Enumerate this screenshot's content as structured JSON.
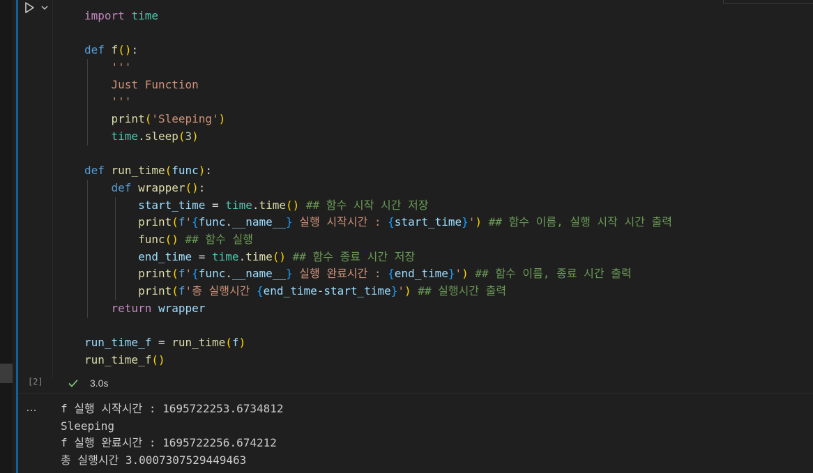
{
  "cell": {
    "execution_count": "[2]",
    "status_time": "3.0s",
    "more_label": "…",
    "icons": {
      "run": "play-icon",
      "run_menu": "chevron-down-icon",
      "status": "check-icon"
    }
  },
  "code": [
    [
      [
        "kw2",
        "import"
      ],
      [
        "op",
        " "
      ],
      [
        "mod",
        "time"
      ]
    ],
    [],
    [
      [
        "kw",
        "def"
      ],
      [
        "op",
        " "
      ],
      [
        "fn",
        "f"
      ],
      [
        "br1",
        "()"
      ],
      [
        "op",
        ":"
      ]
    ],
    [
      [
        "op",
        "    "
      ],
      [
        "str",
        "'''"
      ]
    ],
    [
      [
        "op",
        "    "
      ],
      [
        "str",
        "Just Function"
      ]
    ],
    [
      [
        "op",
        "    "
      ],
      [
        "str",
        "'''"
      ]
    ],
    [
      [
        "op",
        "    "
      ],
      [
        "fn",
        "print"
      ],
      [
        "br1",
        "("
      ],
      [
        "str",
        "'Sleeping'"
      ],
      [
        "br1",
        ")"
      ]
    ],
    [
      [
        "op",
        "    "
      ],
      [
        "mod",
        "time"
      ],
      [
        "op",
        "."
      ],
      [
        "fn",
        "sleep"
      ],
      [
        "br1",
        "("
      ],
      [
        "num",
        "3"
      ],
      [
        "br1",
        ")"
      ]
    ],
    [],
    [
      [
        "kw",
        "def"
      ],
      [
        "op",
        " "
      ],
      [
        "fn",
        "run_time"
      ],
      [
        "br1",
        "("
      ],
      [
        "var",
        "func"
      ],
      [
        "br1",
        ")"
      ],
      [
        "op",
        ":"
      ]
    ],
    [
      [
        "op",
        "    "
      ],
      [
        "kw",
        "def"
      ],
      [
        "op",
        " "
      ],
      [
        "fn",
        "wrapper"
      ],
      [
        "br1",
        "()"
      ],
      [
        "op",
        ":"
      ]
    ],
    [
      [
        "op",
        "        "
      ],
      [
        "var",
        "start_time"
      ],
      [
        "op",
        " = "
      ],
      [
        "mod",
        "time"
      ],
      [
        "op",
        "."
      ],
      [
        "fn",
        "time"
      ],
      [
        "br1",
        "()"
      ],
      [
        "op",
        " "
      ],
      [
        "cmt",
        "## 함수 시작 시간 저장"
      ]
    ],
    [
      [
        "op",
        "        "
      ],
      [
        "fn",
        "print"
      ],
      [
        "br1",
        "("
      ],
      [
        "kw",
        "f"
      ],
      [
        "str",
        "'"
      ],
      [
        "br3",
        "{"
      ],
      [
        "var",
        "func"
      ],
      [
        "op",
        "."
      ],
      [
        "var",
        "__name__"
      ],
      [
        "br3",
        "}"
      ],
      [
        "str",
        " 실행 시작시간 : "
      ],
      [
        "br3",
        "{"
      ],
      [
        "var",
        "start_time"
      ],
      [
        "br3",
        "}"
      ],
      [
        "str",
        "'"
      ],
      [
        "br1",
        ")"
      ],
      [
        "op",
        " "
      ],
      [
        "cmt",
        "## 함수 이름, 실행 시작 시간 출력"
      ]
    ],
    [
      [
        "op",
        "        "
      ],
      [
        "fn",
        "func"
      ],
      [
        "br1",
        "()"
      ],
      [
        "op",
        " "
      ],
      [
        "cmt",
        "## 함수 실행"
      ]
    ],
    [
      [
        "op",
        "        "
      ],
      [
        "var",
        "end_time"
      ],
      [
        "op",
        " = "
      ],
      [
        "mod",
        "time"
      ],
      [
        "op",
        "."
      ],
      [
        "fn",
        "time"
      ],
      [
        "br1",
        "()"
      ],
      [
        "op",
        " "
      ],
      [
        "cmt",
        "## 함수 종료 시간 저장"
      ]
    ],
    [
      [
        "op",
        "        "
      ],
      [
        "fn",
        "print"
      ],
      [
        "br1",
        "("
      ],
      [
        "kw",
        "f"
      ],
      [
        "str",
        "'"
      ],
      [
        "br3",
        "{"
      ],
      [
        "var",
        "func"
      ],
      [
        "op",
        "."
      ],
      [
        "var",
        "__name__"
      ],
      [
        "br3",
        "}"
      ],
      [
        "str",
        " 실행 완료시간 : "
      ],
      [
        "br3",
        "{"
      ],
      [
        "var",
        "end_time"
      ],
      [
        "br3",
        "}"
      ],
      [
        "str",
        "'"
      ],
      [
        "br1",
        ")"
      ],
      [
        "op",
        " "
      ],
      [
        "cmt",
        "## 함수 이름, 종료 시간 출력"
      ]
    ],
    [
      [
        "op",
        "        "
      ],
      [
        "fn",
        "print"
      ],
      [
        "br1",
        "("
      ],
      [
        "kw",
        "f"
      ],
      [
        "str",
        "'총 실행시간 "
      ],
      [
        "br3",
        "{"
      ],
      [
        "var",
        "end_time"
      ],
      [
        "op",
        "-"
      ],
      [
        "var",
        "start_time"
      ],
      [
        "br3",
        "}"
      ],
      [
        "str",
        "'"
      ],
      [
        "br1",
        ")"
      ],
      [
        "op",
        " "
      ],
      [
        "cmt",
        "## 실행시간 출력"
      ]
    ],
    [
      [
        "op",
        "    "
      ],
      [
        "kw2",
        "return"
      ],
      [
        "op",
        " "
      ],
      [
        "var",
        "wrapper"
      ]
    ],
    [],
    [
      [
        "var",
        "run_time_f"
      ],
      [
        "op",
        " = "
      ],
      [
        "fn",
        "run_time"
      ],
      [
        "br1",
        "("
      ],
      [
        "var",
        "f"
      ],
      [
        "br1",
        ")"
      ]
    ],
    [
      [
        "fn",
        "run_time_f"
      ],
      [
        "br1",
        "()"
      ]
    ]
  ],
  "output": [
    "f 실행 시작시간 : 1695722253.6734812",
    "Sleeping",
    "f 실행 완료시간 : 1695722256.674212",
    "총 실행시간 3.0007307529449463"
  ]
}
